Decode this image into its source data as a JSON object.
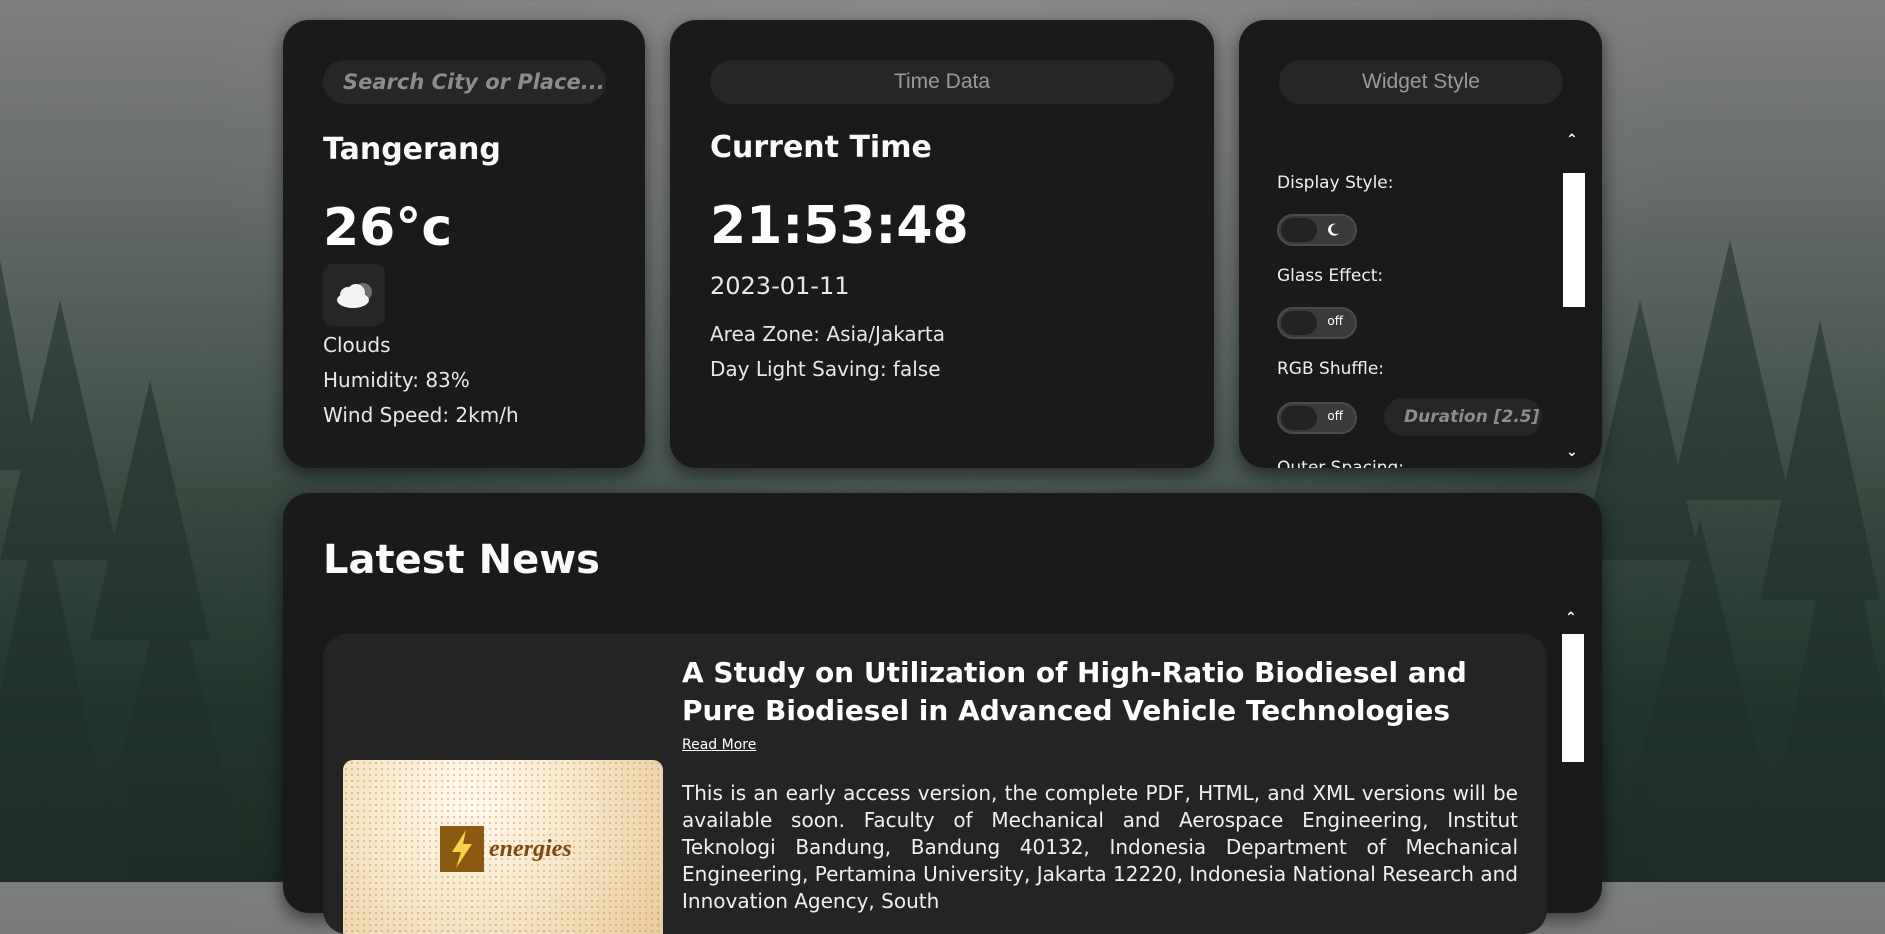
{
  "weather": {
    "search_placeholder": "Search City or Place...",
    "city": "Tangerang",
    "temperature": "26°c",
    "condition_icon": "cloud-moon-icon",
    "condition": "Clouds",
    "humidity": "Humidity: 83%",
    "wind": "Wind Speed: 2km/h"
  },
  "time": {
    "header": "Time Data",
    "title": "Current Time",
    "clock": "21:53:48",
    "date": "2023-01-11",
    "zone": "Area Zone: Asia/Jakarta",
    "dst": "Day Light Saving: false"
  },
  "widget_style": {
    "header": "Widget Style",
    "display_style_label": "Display Style:",
    "display_style_icon": "moon-icon",
    "glass_effect_label": "Glass Effect:",
    "glass_effect_state": "off",
    "rgb_shuffle_label": "RGB Shuffle:",
    "rgb_shuffle_state": "off",
    "duration_placeholder": "Duration [2.5]",
    "outer_spacing_label": "Outer Spacing:"
  },
  "news": {
    "header": "Latest News",
    "items": [
      {
        "title": "A Study on Utilization of High-Ratio Biodiesel and Pure Biodiesel in Advanced Vehicle Technologies",
        "read_more": "Read More",
        "image_label": "energies",
        "body": "This is an early access version, the complete PDF, HTML, and XML versions will be available soon. Faculty of Mechanical and Aerospace Engineering, Institut Teknologi Bandung, Bandung 40132, Indonesia Department of Mechanical Engineering, Pertamina University, Jakarta 12220, Indonesia National Research and Innovation Agency, South"
      }
    ]
  },
  "colors": {
    "card_bg": "#1a1a1a",
    "pill_bg": "#262626",
    "news_card_bg": "#242424",
    "journal_accent": "#8a5a12"
  }
}
